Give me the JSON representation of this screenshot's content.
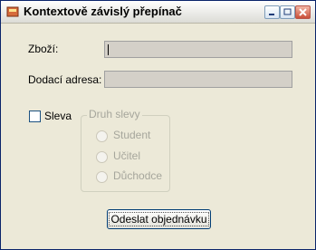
{
  "window": {
    "title": "Kontextově závislý přepínač"
  },
  "form": {
    "zbozi_label": "Zboží:",
    "zbozi_value": "",
    "adresa_label": "Dodací adresa:",
    "adresa_value": "",
    "sleva_label": "Sleva",
    "sleva_checked": false,
    "group_title": "Druh slevy",
    "options": [
      "Student",
      "Učitel",
      "Důchodce"
    ],
    "submit_label": "Odeslat objednávku"
  }
}
